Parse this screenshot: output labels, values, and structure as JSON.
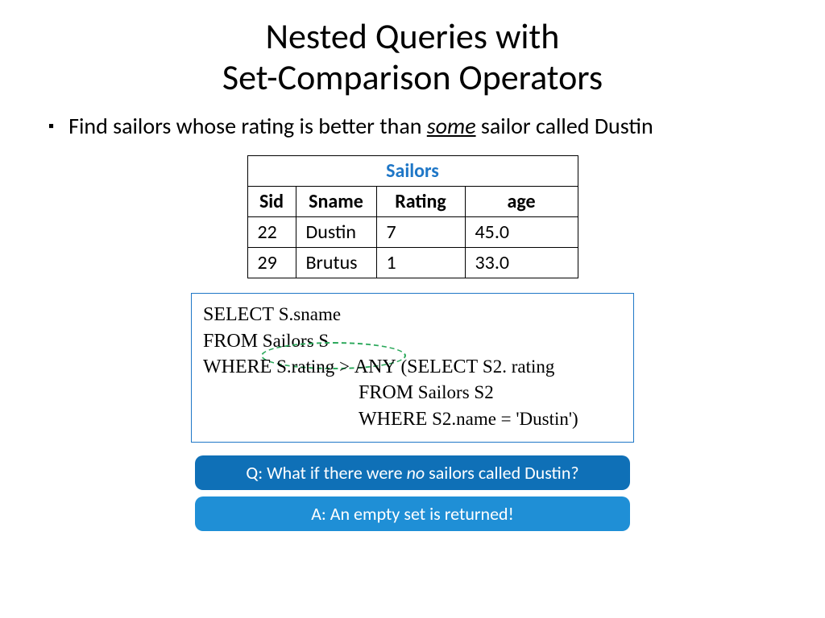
{
  "title_line1": "Nested Queries with",
  "title_line2": "Set-Comparison Operators",
  "bullet_glyph": "▪",
  "bullet_pre": "Find sailors whose rating is better than ",
  "bullet_em": "some",
  "bullet_post": " sailor called Dustin",
  "table": {
    "caption": "Sailors",
    "headers": {
      "c0": "Sid",
      "c1": "Sname",
      "c2": "Rating",
      "c3": "age"
    },
    "rows": [
      {
        "sid": "22",
        "sname": "Dustin",
        "rating": "7",
        "age": "45.0"
      },
      {
        "sid": "29",
        "sname": "Brutus",
        "rating": "1",
        "age": "33.0"
      }
    ]
  },
  "sql": {
    "select_kw": "SELECT",
    "select_args": "  S.sname",
    "from_kw": "FROM",
    "from_args": "  Sailors S",
    "where_kw": "WHERE",
    "where_cond": "  S.rating > ",
    "any_kw": "ANY",
    "paren_open": "  (",
    "sub_select_kw": "SELECT",
    "sub_select_args": "  S2. rating",
    "sub_from_kw": "FROM",
    "sub_from_args": "  Sailors S2",
    "sub_where_kw": "WHERE",
    "sub_where_args": "  S2.name = 'Dustin')"
  },
  "q_pre": "Q: What if there were ",
  "q_em": "no",
  "q_post": " sailors called Dustin?",
  "a_text": "A: An empty set is returned!"
}
